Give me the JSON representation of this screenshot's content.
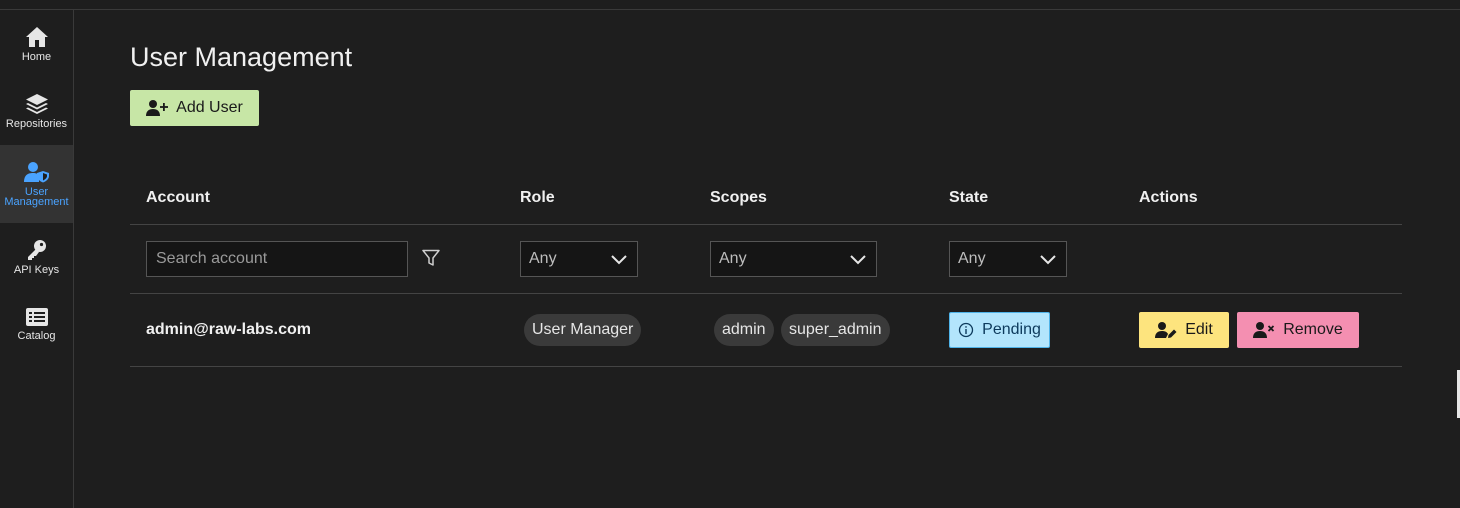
{
  "sidebar": {
    "items": [
      {
        "label": "Home",
        "icon": "home-icon"
      },
      {
        "label": "Repositories",
        "icon": "layers-icon"
      },
      {
        "label": "User Management",
        "icon": "user-shield-icon",
        "active": true
      },
      {
        "label": "API Keys",
        "icon": "key-icon"
      },
      {
        "label": "Catalog",
        "icon": "list-icon"
      }
    ],
    "active_color": "#4aa3ff"
  },
  "page": {
    "title": "User Management",
    "add_user_label": "Add User"
  },
  "table": {
    "headers": {
      "account": "Account",
      "role": "Role",
      "scopes": "Scopes",
      "state": "State",
      "actions": "Actions"
    },
    "filters": {
      "search_placeholder": "Search account",
      "role": "Any",
      "scopes": "Any",
      "state": "Any"
    },
    "rows": [
      {
        "account": "admin@raw-labs.com",
        "role": "User Manager",
        "scopes": [
          "admin",
          "super_admin"
        ],
        "state": "Pending",
        "edit_label": "Edit",
        "remove_label": "Remove"
      }
    ]
  },
  "colors": {
    "add_user_bg": "#c7e6a6",
    "pending_bg": "#b3e5fc",
    "edit_bg": "#fde47e",
    "remove_bg": "#f48fb1"
  }
}
